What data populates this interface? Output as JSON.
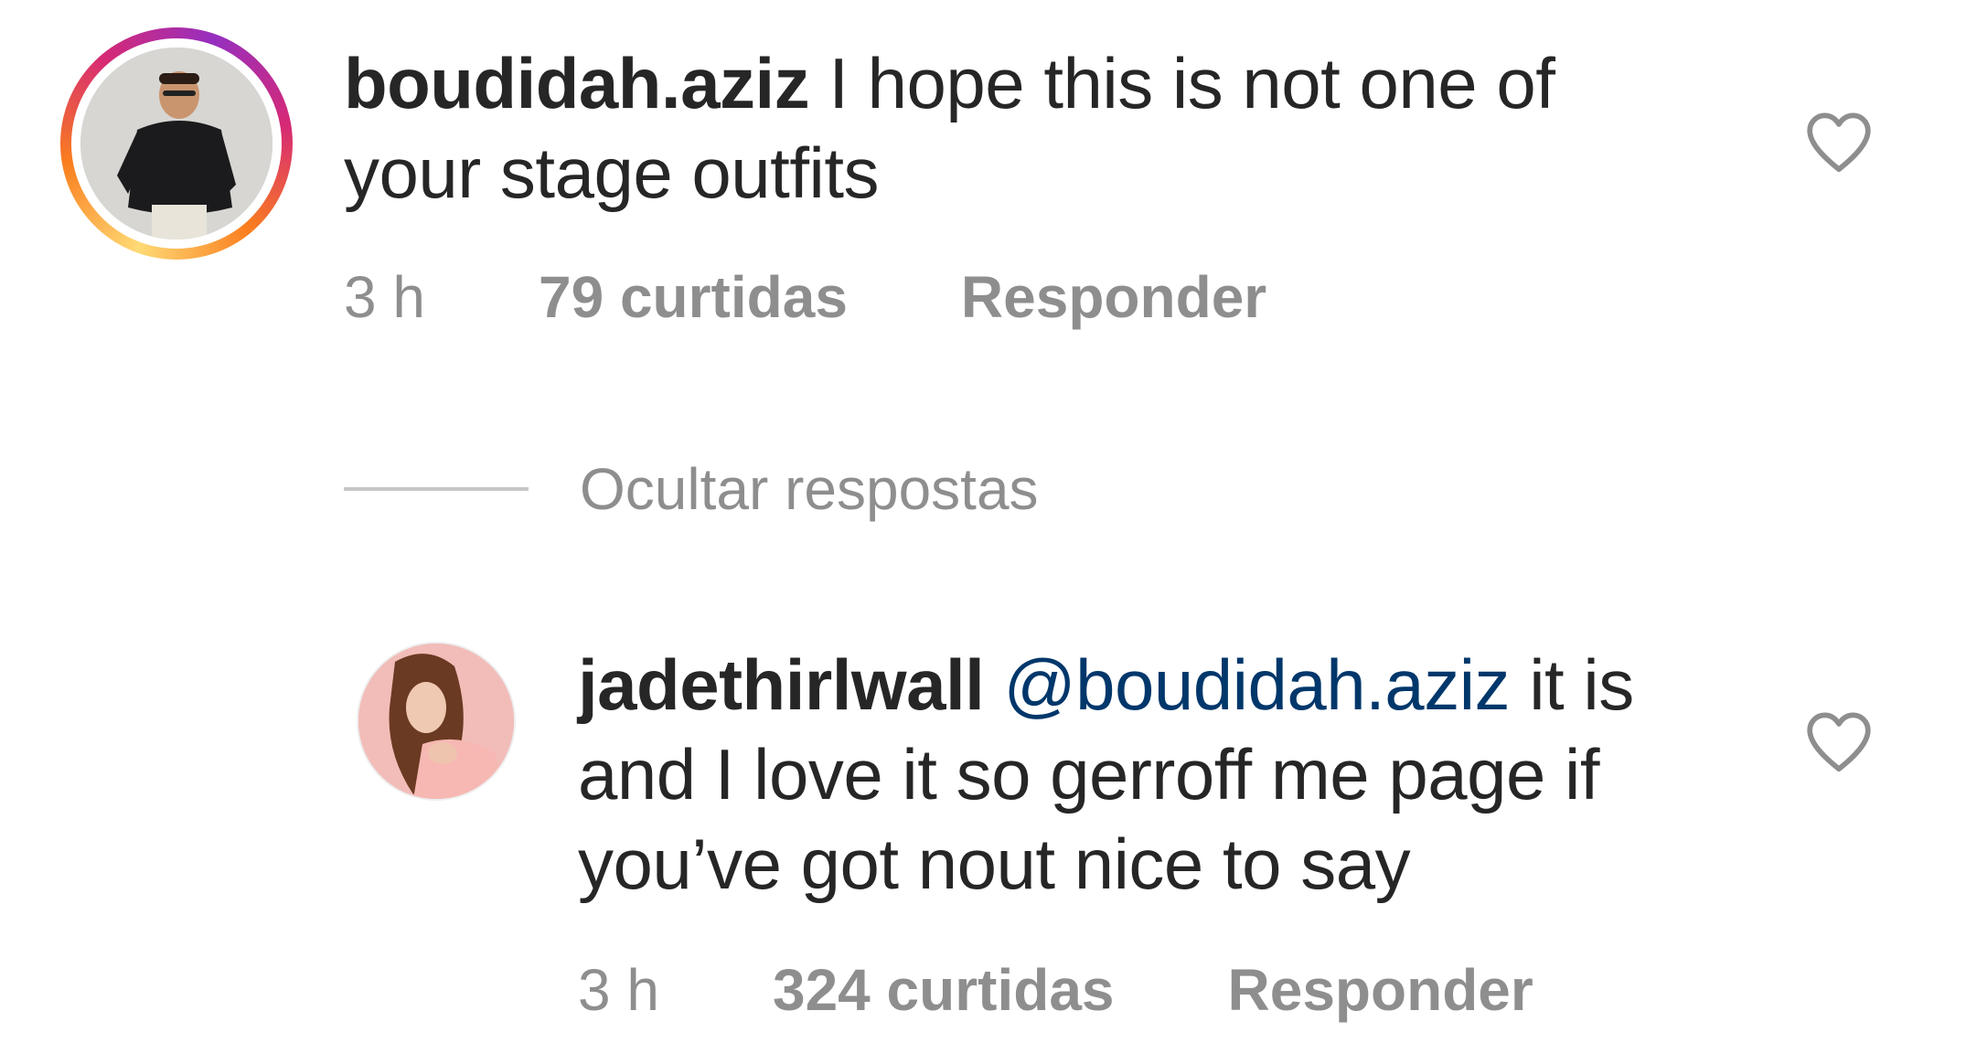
{
  "comments": [
    {
      "username": "boudidah.aziz",
      "text": "I hope this is not one of your stage outfits",
      "time": "3 h",
      "likes": "79 curtidas",
      "reply_label": "Responder"
    }
  ],
  "hide_replies_label": "Ocultar respostas",
  "replies": [
    {
      "username": "jadethirlwall",
      "mention": "@boudidah.aziz",
      "text": "it is and I love it so gerroff me page if you’ve got nout nice to say",
      "time": "3 h",
      "likes": "324 curtidas",
      "reply_label": "Responder"
    }
  ],
  "icons": {
    "like": "heart-outline-icon",
    "avatar_ring": "story-ring"
  },
  "colors": {
    "text": "#262626",
    "meta": "#8e8e8e",
    "mention": "#00376b",
    "divider": "#c7c7c7"
  }
}
